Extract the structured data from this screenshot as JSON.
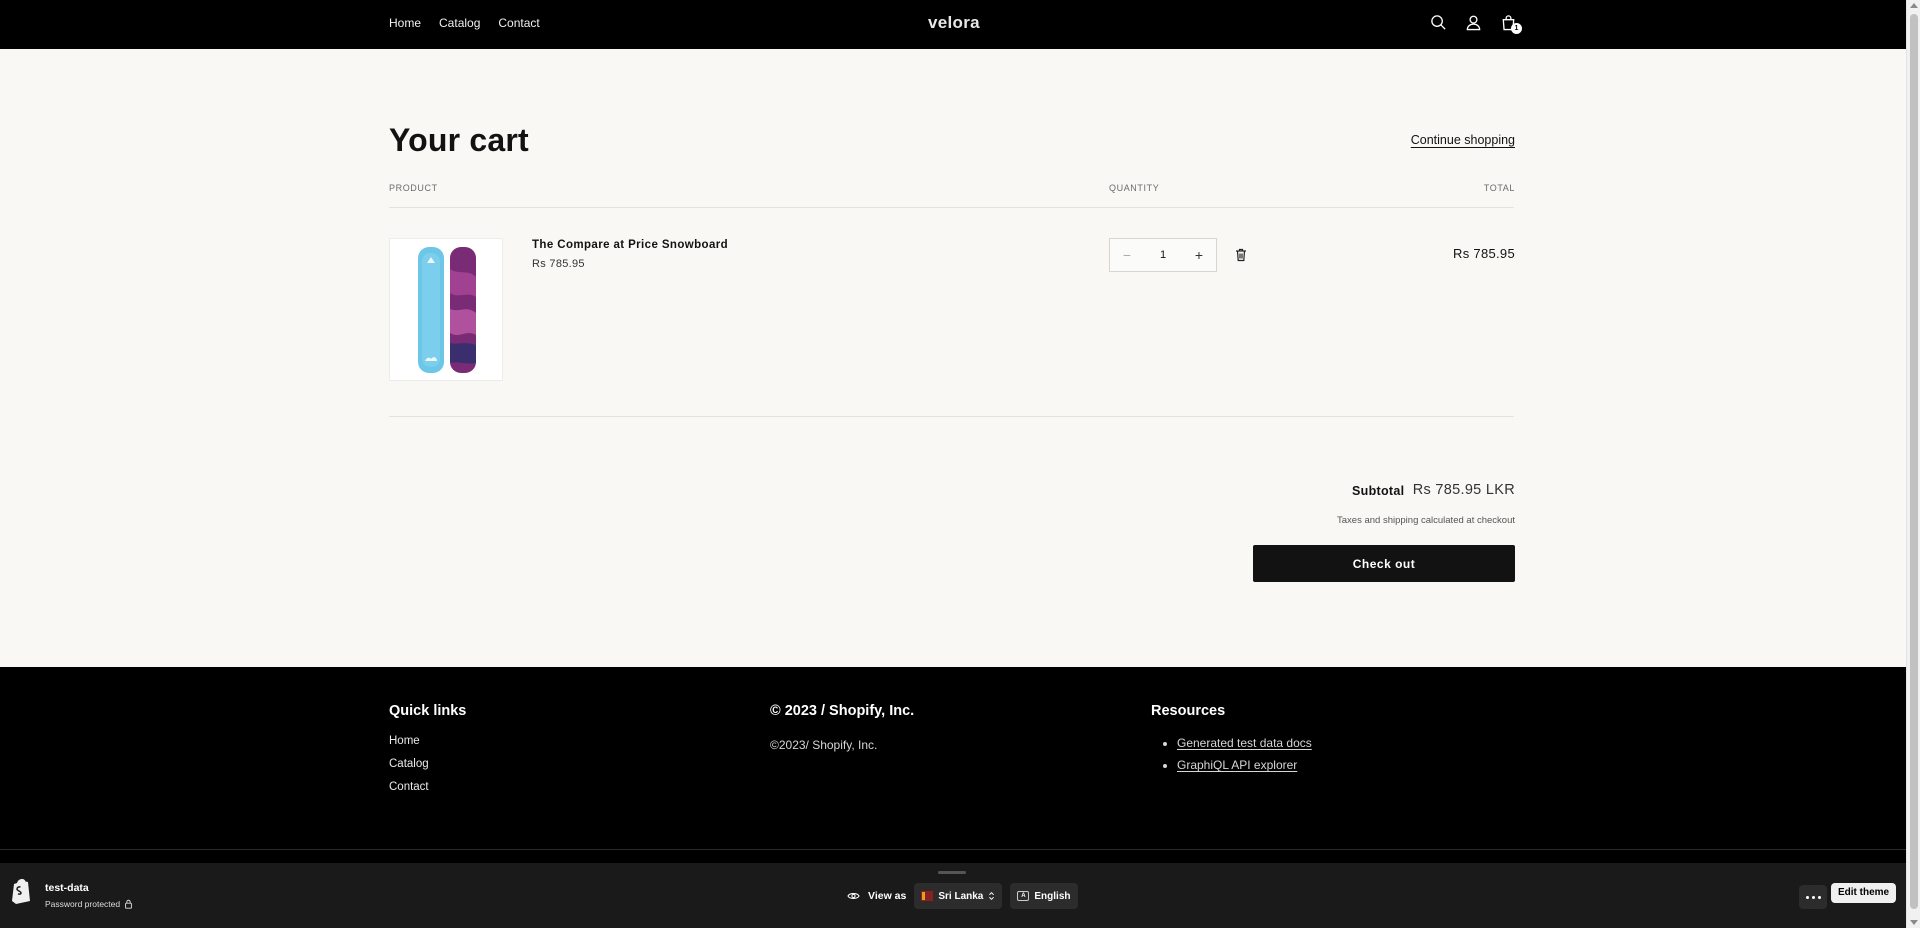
{
  "header": {
    "nav": [
      "Home",
      "Catalog",
      "Contact"
    ],
    "brand": "velora",
    "cart_count": "1"
  },
  "cart": {
    "title": "Your cart",
    "continue_shopping": "Continue shopping",
    "columns": {
      "product": "PRODUCT",
      "quantity": "QUANTITY",
      "total": "TOTAL"
    },
    "item": {
      "name": "The Compare at Price Snowboard",
      "price": "Rs 785.95",
      "quantity": "1",
      "line_total": "Rs 785.95",
      "minus": "−",
      "plus": "+"
    },
    "subtotal_label": "Subtotal",
    "subtotal_value": "Rs 785.95 LKR",
    "tax_note": "Taxes and shipping calculated at checkout",
    "checkout_label": "Check out"
  },
  "footer": {
    "quick_links_title": "Quick links",
    "quick_links": [
      "Home",
      "Catalog",
      "Contact"
    ],
    "copyright_title": "© 2023 / Shopify, Inc.",
    "copyright_text": "©2023/ Shopify, Inc.",
    "resources_title": "Resources",
    "resources": [
      "Generated test data docs",
      "GraphiQL API explorer"
    ]
  },
  "preview_bar": {
    "store_name": "test-data",
    "store_status": "Password protected",
    "view_as": "View as",
    "country": "Sri Lanka",
    "language": "English",
    "edit_theme": "Edit theme"
  },
  "colors": {
    "header_bg": "#000000",
    "page_bg": "#f9f8f5",
    "button": "#121212",
    "board_light": "#6cc6e8",
    "board_dark": "#7a2b76"
  },
  "icons": [
    "search-icon",
    "account-icon",
    "cart-icon",
    "trash-icon",
    "eye-icon",
    "lock-icon",
    "shopify-logo"
  ]
}
